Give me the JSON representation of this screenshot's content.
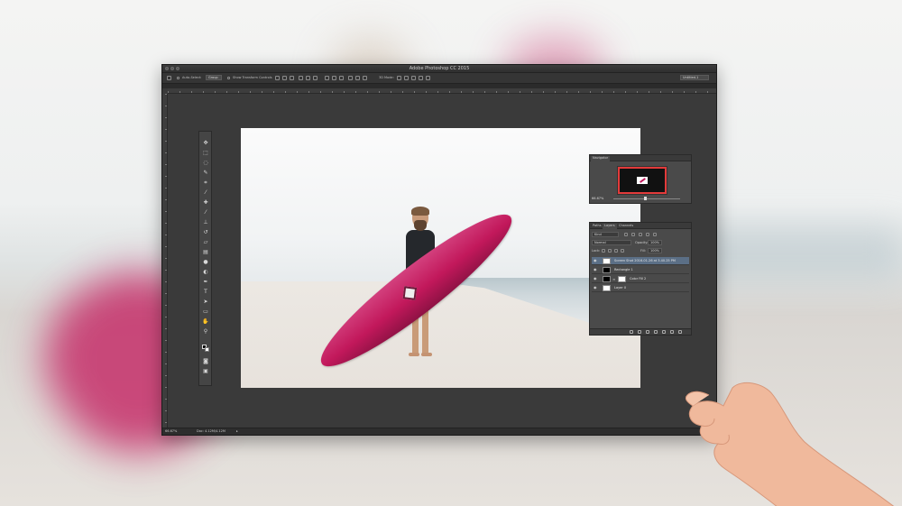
{
  "app": {
    "window_title": "Adobe Photoshop CC 2015",
    "workspace_label": "Untitled-1"
  },
  "options_bar": {
    "auto_select_label": "Auto-Select:",
    "auto_select_value": "Group",
    "transform_controls_label": "Show Transform Controls",
    "mode_3d_label": "3D Mode:"
  },
  "status_bar": {
    "zoom": "66.67%",
    "doc_info": "Doc: 4.12M/4.12M"
  },
  "navigator": {
    "tab": "Navigator",
    "zoom": "66.67%"
  },
  "layers_panel": {
    "tabs": [
      "Paths",
      "Layers",
      "Channels"
    ],
    "filter_kind": "Kind",
    "blend_mode": "Normal",
    "opacity_label": "Opacity:",
    "opacity_value": "100%",
    "lock_label": "Lock:",
    "fill_label": "Fill:",
    "fill_value": "100%",
    "layers": [
      {
        "name": "Screen Shot 2016-01-26 at 3.40.25 PM",
        "selected": true
      },
      {
        "name": "Rectangle 1",
        "selected": false
      },
      {
        "name": "Color Fill 2",
        "selected": false
      },
      {
        "name": "Layer 0",
        "selected": false
      }
    ]
  },
  "icons": {
    "move_tool": "move-icon",
    "zoom_tool": "zoom-icon",
    "hand_tool": "hand-icon",
    "visibility": "eye-icon"
  },
  "colors": {
    "surfboard": "#c2185b",
    "selected_layer": "#5b6f86",
    "navigator_view_box": "#e23a3a"
  }
}
